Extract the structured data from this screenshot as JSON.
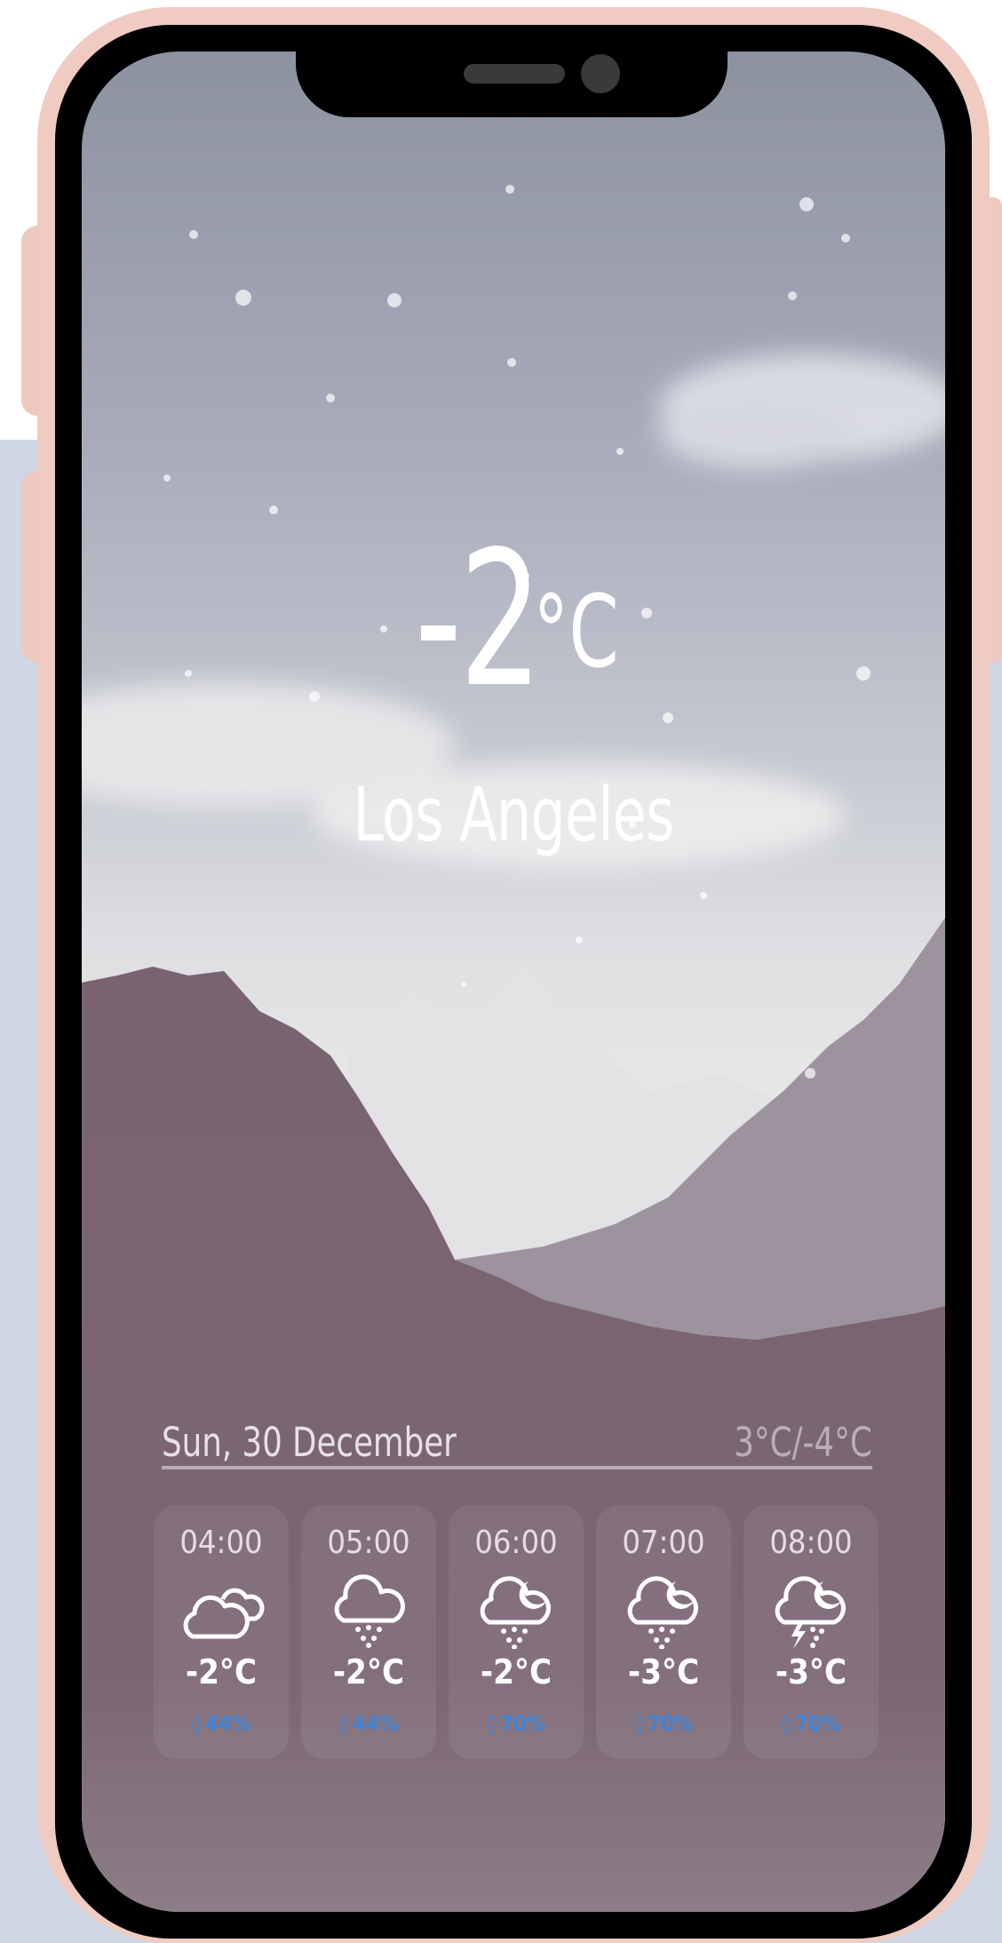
{
  "weather": {
    "current_temp": "-2",
    "unit": "°C",
    "city": "Los Angeles",
    "date": "Sun, 30 December",
    "range": "3°C/-4°C"
  },
  "hourly": [
    {
      "time": "04:00",
      "icon": "cloudy-icon",
      "temp": "-2°C",
      "precip": "44%"
    },
    {
      "time": "05:00",
      "icon": "snow-icon",
      "temp": "-2°C",
      "precip": "44%"
    },
    {
      "time": "06:00",
      "icon": "snow-night-icon",
      "temp": "-2°C",
      "precip": "70%"
    },
    {
      "time": "07:00",
      "icon": "snow-night-icon",
      "temp": "-3°C",
      "precip": "70%"
    },
    {
      "time": "08:00",
      "icon": "thunder-snow-night-icon",
      "temp": "-3°C",
      "precip": "70%"
    }
  ],
  "colors": {
    "frame": "#efcbc2",
    "panel": "#d0d6e4",
    "mountain_dark": "#79636f",
    "precip_blue": "#3f84d6"
  }
}
